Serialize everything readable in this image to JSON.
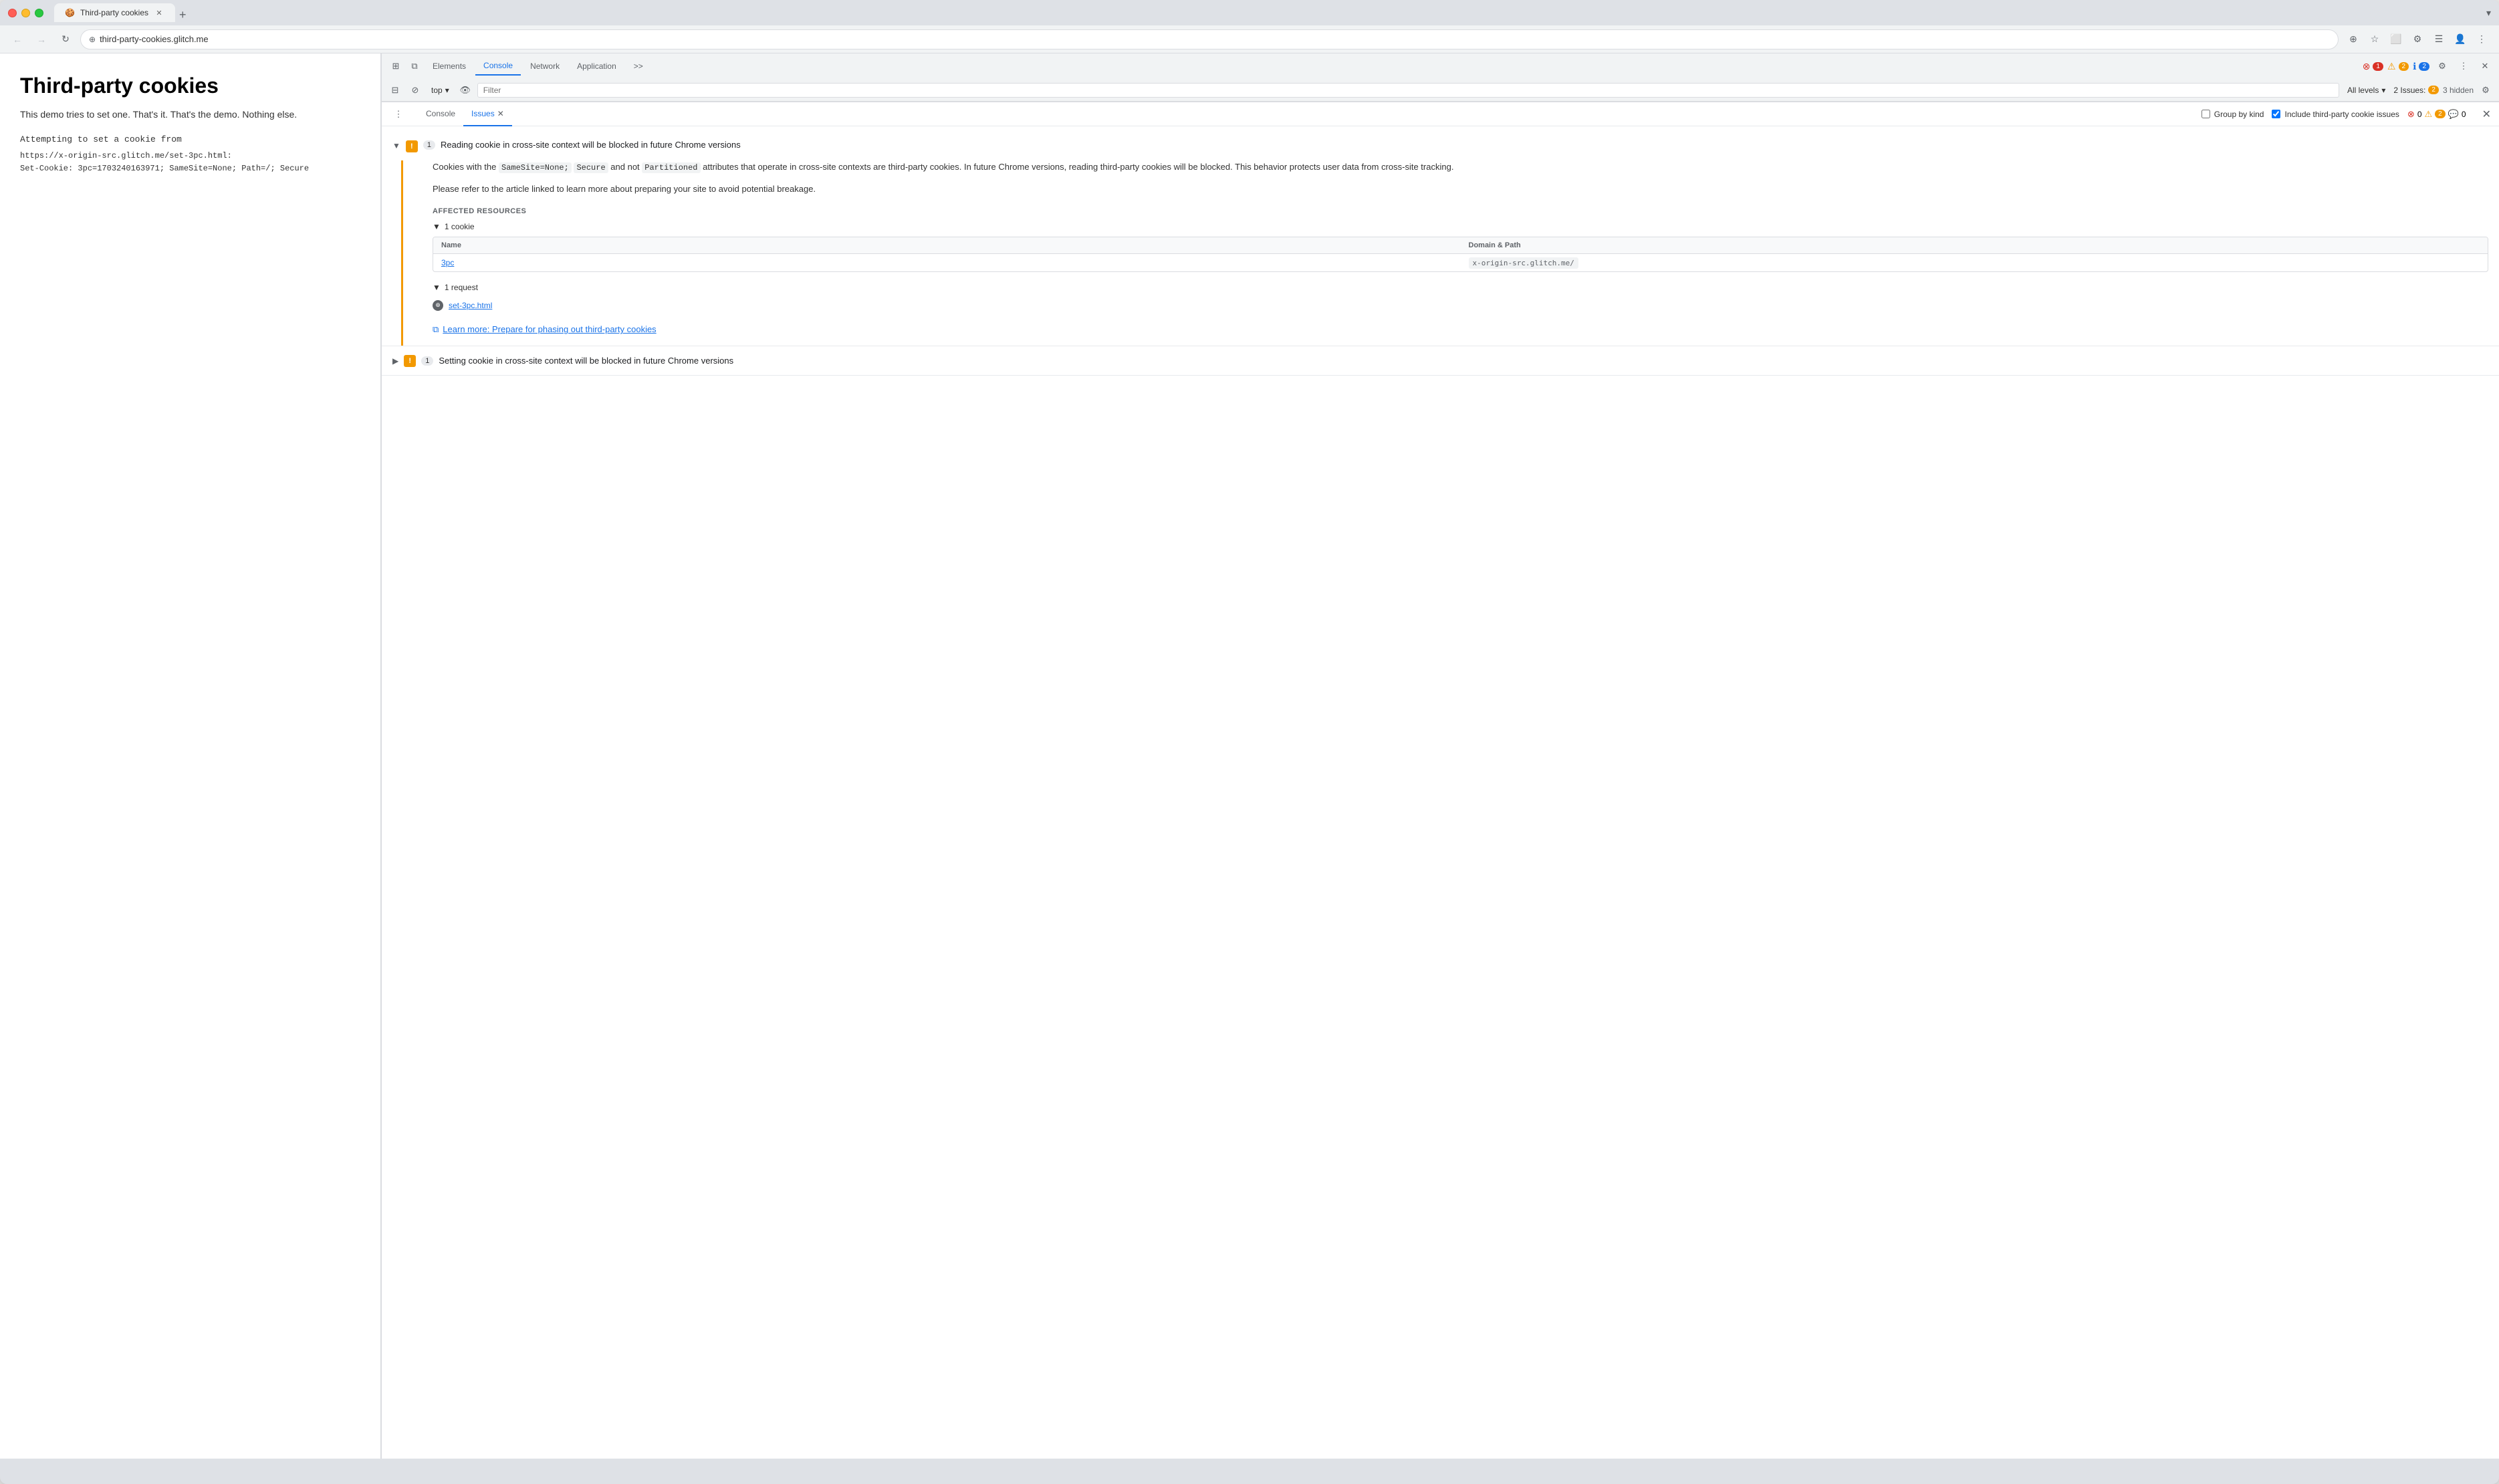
{
  "browser": {
    "tab_title": "Third-party cookies",
    "url": "third-party-cookies.glitch.me",
    "tab_favicon": "🍪"
  },
  "webpage": {
    "heading": "Third-party cookies",
    "description": "This demo tries to set one. That's it. That's the demo. Nothing else.",
    "log_label": "Attempting to set a cookie from",
    "log_url": "https://x-origin-src.glitch.me/set-3pc.html:",
    "log_cookie": "Set-Cookie: 3pc=1703240163971; SameSite=None; Path=/; Secure"
  },
  "devtools": {
    "tabs": [
      {
        "id": "elements",
        "label": "Elements",
        "active": false
      },
      {
        "id": "console",
        "label": "Console",
        "active": true
      },
      {
        "id": "network",
        "label": "Network",
        "active": false
      },
      {
        "id": "application",
        "label": "Application",
        "active": false
      }
    ],
    "error_count": "1",
    "warn_count": "2",
    "info_count": "2",
    "more_label": ">>",
    "toolbar": {
      "top_label": "top",
      "filter_placeholder": "Filter",
      "levels_label": "All levels",
      "issues_label": "2 Issues:",
      "hidden_label": "3 hidden"
    },
    "panels": {
      "console_label": "Console",
      "issues_label": "Issues"
    }
  },
  "issues": {
    "group_by_label": "Group by kind",
    "include_third_party_label": "Include third-party cookie issues",
    "error_badge": "0",
    "warn_badge": "2",
    "info_badge": "0",
    "issue1": {
      "count": "1",
      "title": "Reading cookie in cross-site context will be blocked in future Chrome versions",
      "description1": "Cookies with the",
      "code1": "SameSite=None;",
      "code2": "Secure",
      "description2": "and not",
      "code3": "Partitioned",
      "description3": "attributes that operate in cross-site contexts are third-party cookies. In future Chrome versions, reading third-party cookies will be blocked. This behavior protects user data from cross-site tracking.",
      "description4": "Please refer to the article linked to learn more about preparing your site to avoid potential breakage.",
      "affected_label": "AFFECTED RESOURCES",
      "cookie_toggle": "1 cookie",
      "col_name": "Name",
      "col_domain": "Domain & Path",
      "cookie_name": "3pc",
      "cookie_domain": "x-origin-src.glitch.me/",
      "request_toggle": "1 request",
      "request_link": "set-3pc.html",
      "learn_more_text": "Learn more: Prepare for phasing out third-party cookies"
    },
    "issue2": {
      "count": "1",
      "title": "Setting cookie in cross-site context will be blocked in future Chrome versions"
    }
  }
}
